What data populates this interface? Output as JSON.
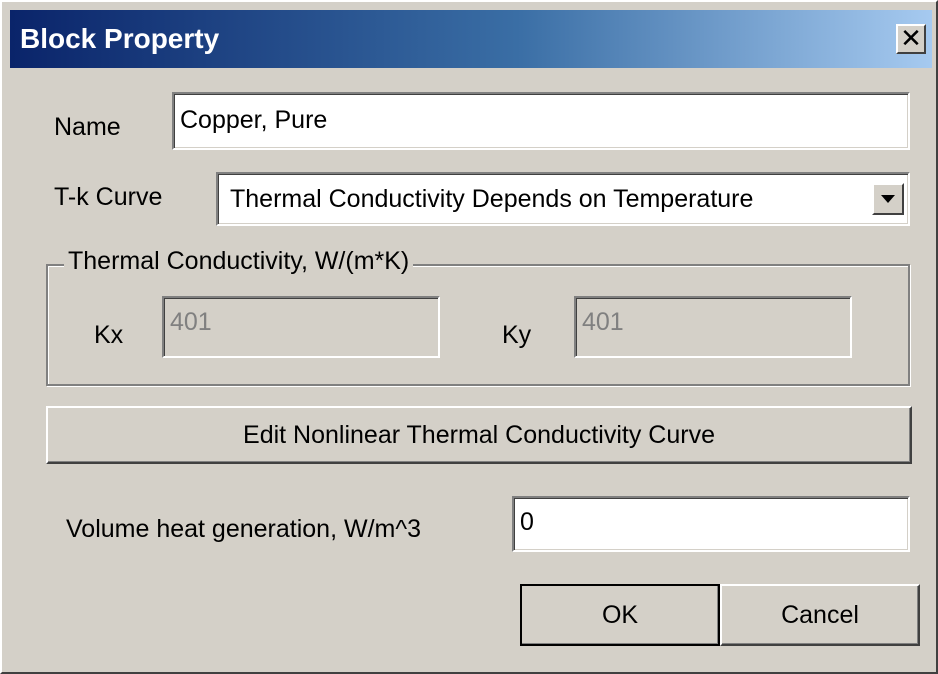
{
  "window": {
    "title": "Block Property",
    "close_glyph": "✕"
  },
  "form": {
    "name_label": "Name",
    "name_value": "Copper, Pure",
    "tk_label": "T-k Curve",
    "tk_selected": "Thermal Conductivity Depends on Temperature",
    "group_title": "Thermal Conductivity, W/(m*K)",
    "kx_label": "Kx",
    "kx_value": "401",
    "ky_label": "Ky",
    "ky_value": "401",
    "edit_curve_button": "Edit Nonlinear Thermal Conductivity Curve",
    "heat_label": "Volume heat generation, W/m^3",
    "heat_value": "0"
  },
  "buttons": {
    "ok": "OK",
    "cancel": "Cancel"
  },
  "icons": {
    "close": "close-icon",
    "dropdown": "chevron-down-icon"
  },
  "colors": {
    "dialog_bg": "#d4d0c8",
    "titlebar_start": "#0a246a",
    "titlebar_end": "#a6caf0",
    "disabled_text": "#808080"
  }
}
